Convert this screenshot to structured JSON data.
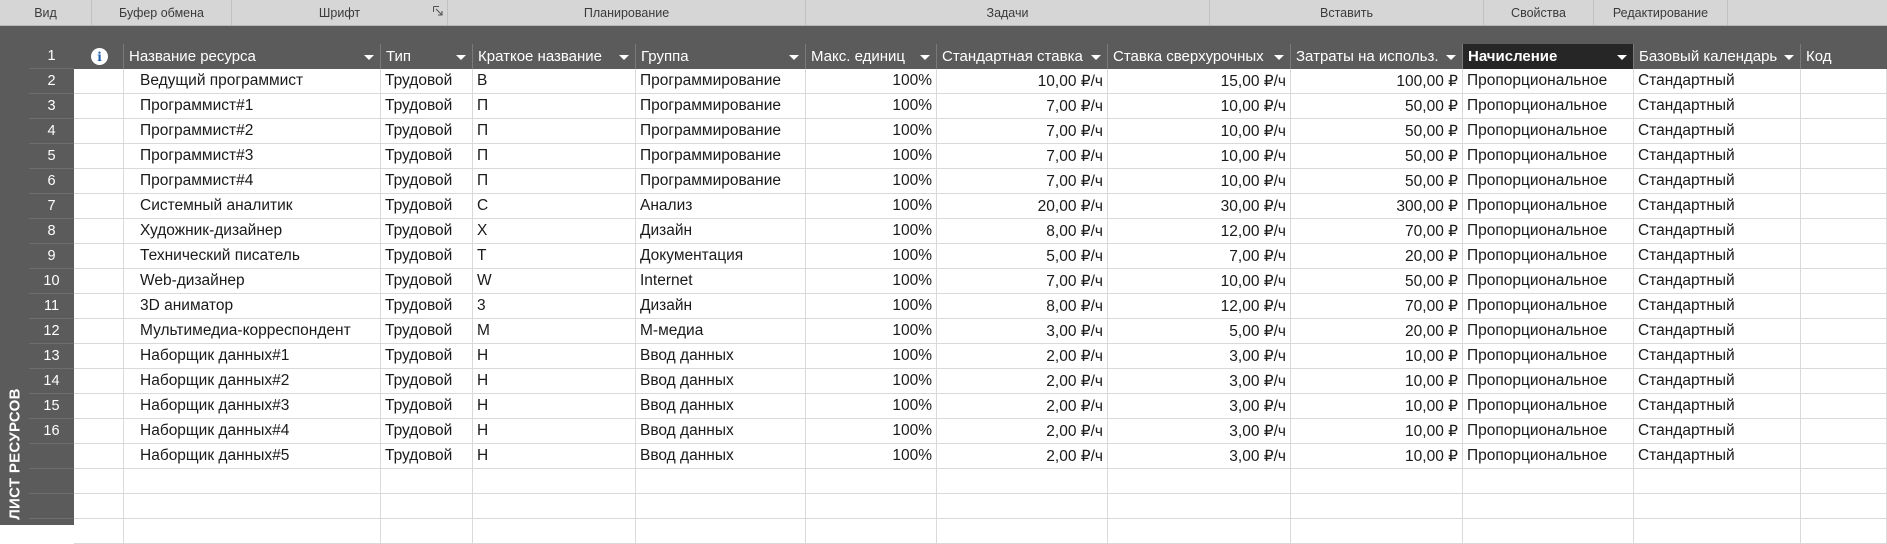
{
  "ribbon": {
    "groups": [
      "Вид",
      "Буфер обмена",
      "Шрифт",
      "Планирование",
      "Задачи",
      "Вставить",
      "Свойства",
      "Редактирование"
    ]
  },
  "view_bar": {
    "label": "ЛИСТ РЕСУРСОВ"
  },
  "table": {
    "columns": [
      "",
      "Название ресурса",
      "Тип",
      "Краткое название",
      "Группа",
      "Макс. единиц",
      "Стандартная ставка",
      "Ставка сверхурочных",
      "Затраты на использ.",
      "Начисление",
      "Базовый календарь",
      "Код"
    ],
    "active_column": "Начисление",
    "rows": [
      {
        "id": "1",
        "name": "Ведущий программист",
        "type": "Трудовой",
        "short": "В",
        "group": "Программирование",
        "max": "100%",
        "std": "10,00 ₽/ч",
        "ovt": "15,00 ₽/ч",
        "cost": "100,00 ₽",
        "accrue": "Пропорциональное",
        "cal": "Стандартный"
      },
      {
        "id": "2",
        "name": "Программист#1",
        "type": "Трудовой",
        "short": "П",
        "group": "Программирование",
        "max": "100%",
        "std": "7,00 ₽/ч",
        "ovt": "10,00 ₽/ч",
        "cost": "50,00 ₽",
        "accrue": "Пропорциональное",
        "cal": "Стандартный"
      },
      {
        "id": "3",
        "name": "Программист#2",
        "type": "Трудовой",
        "short": "П",
        "group": "Программирование",
        "max": "100%",
        "std": "7,00 ₽/ч",
        "ovt": "10,00 ₽/ч",
        "cost": "50,00 ₽",
        "accrue": "Пропорциональное",
        "cal": "Стандартный"
      },
      {
        "id": "4",
        "name": "Программист#3",
        "type": "Трудовой",
        "short": "П",
        "group": "Программирование",
        "max": "100%",
        "std": "7,00 ₽/ч",
        "ovt": "10,00 ₽/ч",
        "cost": "50,00 ₽",
        "accrue": "Пропорциональное",
        "cal": "Стандартный"
      },
      {
        "id": "5",
        "name": "Программист#4",
        "type": "Трудовой",
        "short": "П",
        "group": "Программирование",
        "max": "100%",
        "std": "7,00 ₽/ч",
        "ovt": "10,00 ₽/ч",
        "cost": "50,00 ₽",
        "accrue": "Пропорциональное",
        "cal": "Стандартный"
      },
      {
        "id": "6",
        "name": "Системный аналитик",
        "type": "Трудовой",
        "short": "С",
        "group": "Анализ",
        "max": "100%",
        "std": "20,00 ₽/ч",
        "ovt": "30,00 ₽/ч",
        "cost": "300,00 ₽",
        "accrue": "Пропорциональное",
        "cal": "Стандартный"
      },
      {
        "id": "7",
        "name": "Художник-дизайнер",
        "type": "Трудовой",
        "short": "Х",
        "group": "Дизайн",
        "max": "100%",
        "std": "8,00 ₽/ч",
        "ovt": "12,00 ₽/ч",
        "cost": "70,00 ₽",
        "accrue": "Пропорциональное",
        "cal": "Стандартный"
      },
      {
        "id": "8",
        "name": "Технический писатель",
        "type": "Трудовой",
        "short": "Т",
        "group": "Документация",
        "max": "100%",
        "std": "5,00 ₽/ч",
        "ovt": "7,00 ₽/ч",
        "cost": "20,00 ₽",
        "accrue": "Пропорциональное",
        "cal": "Стандартный"
      },
      {
        "id": "9",
        "name": "Web-дизайнер",
        "type": "Трудовой",
        "short": "W",
        "group": "Internet",
        "max": "100%",
        "std": "7,00 ₽/ч",
        "ovt": "10,00 ₽/ч",
        "cost": "50,00 ₽",
        "accrue": "Пропорциональное",
        "cal": "Стандартный"
      },
      {
        "id": "10",
        "name": "3D аниматор",
        "type": "Трудовой",
        "short": "3",
        "group": "Дизайн",
        "max": "100%",
        "std": "8,00 ₽/ч",
        "ovt": "12,00 ₽/ч",
        "cost": "70,00 ₽",
        "accrue": "Пропорциональное",
        "cal": "Стандартный"
      },
      {
        "id": "11",
        "name": "Мультимедиа-корреспондент",
        "type": "Трудовой",
        "short": "М",
        "group": "М-медиа",
        "max": "100%",
        "std": "3,00 ₽/ч",
        "ovt": "5,00 ₽/ч",
        "cost": "20,00 ₽",
        "accrue": "Пропорциональное",
        "cal": "Стандартный"
      },
      {
        "id": "12",
        "name": "Наборщик данных#1",
        "type": "Трудовой",
        "short": "Н",
        "group": "Ввод данных",
        "max": "100%",
        "std": "2,00 ₽/ч",
        "ovt": "3,00 ₽/ч",
        "cost": "10,00 ₽",
        "accrue": "Пропорциональное",
        "cal": "Стандартный"
      },
      {
        "id": "13",
        "name": "Наборщик данных#2",
        "type": "Трудовой",
        "short": "Н",
        "group": "Ввод данных",
        "max": "100%",
        "std": "2,00 ₽/ч",
        "ovt": "3,00 ₽/ч",
        "cost": "10,00 ₽",
        "accrue": "Пропорциональное",
        "cal": "Стандартный"
      },
      {
        "id": "14",
        "name": "Наборщик данных#3",
        "type": "Трудовой",
        "short": "Н",
        "group": "Ввод данных",
        "max": "100%",
        "std": "2,00 ₽/ч",
        "ovt": "3,00 ₽/ч",
        "cost": "10,00 ₽",
        "accrue": "Пропорциональное",
        "cal": "Стандартный"
      },
      {
        "id": "15",
        "name": "Наборщик данных#4",
        "type": "Трудовой",
        "short": "Н",
        "group": "Ввод данных",
        "max": "100%",
        "std": "2,00 ₽/ч",
        "ovt": "3,00 ₽/ч",
        "cost": "10,00 ₽",
        "accrue": "Пропорциональное",
        "cal": "Стандартный"
      },
      {
        "id": "16",
        "name": "Наборщик данных#5",
        "type": "Трудовой",
        "short": "Н",
        "group": "Ввод данных",
        "max": "100%",
        "std": "2,00 ₽/ч",
        "ovt": "3,00 ₽/ч",
        "cost": "10,00 ₽",
        "accrue": "Пропорциональное",
        "cal": "Стандартный"
      }
    ]
  },
  "colors": {
    "chrome": "#5b5b5b",
    "active_header": "#262626",
    "ribbon": "#d6d6d6",
    "info_icon": "#1e5ca8"
  },
  "icons": {
    "indicator_header": "info-icon",
    "dialog_launcher": "dialog-launcher-icon",
    "column_filter": "filter-arrow-icon"
  }
}
